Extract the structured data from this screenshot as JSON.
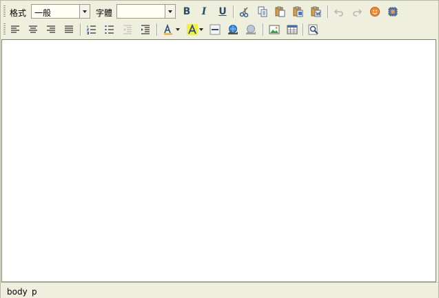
{
  "toolbar": {
    "format_label": "格式",
    "format_value": "一般",
    "font_label": "字體",
    "font_value": "",
    "bold": "B",
    "italic": "I",
    "underline": "U"
  },
  "statusbar": {
    "path": [
      "body",
      "p"
    ]
  },
  "icons": {
    "cut": "scissors-icon",
    "copy": "copy-icon",
    "paste": "paste-icon",
    "paste_text": "paste-text-icon",
    "paste_word": "paste-word-icon",
    "undo": "undo-icon",
    "redo": "redo-icon",
    "emoticon": "smiley-icon",
    "source": "chip-icon"
  }
}
